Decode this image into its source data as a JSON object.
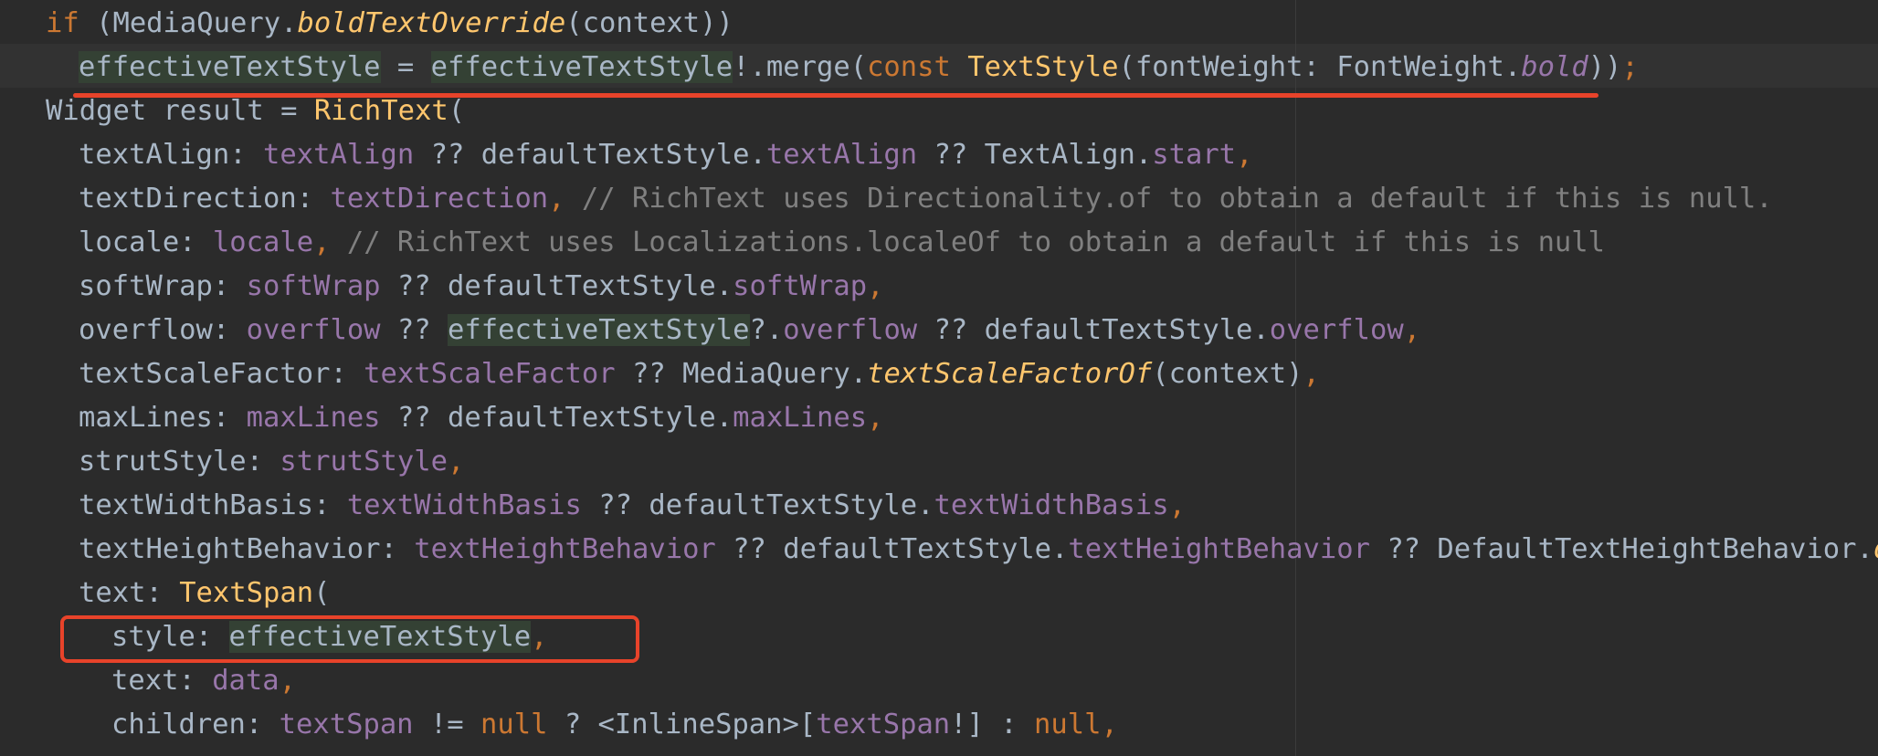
{
  "editor": {
    "colors": {
      "background": "#2b2b2b",
      "current_line": "#323232",
      "default_text": "#a9b7c6",
      "keyword": "#cc7832",
      "class_or_method": "#ffc66d",
      "field": "#9876aa",
      "comment": "#808080",
      "reference_highlight": "#344134",
      "annotation": "#e8432a"
    },
    "lines": [
      {
        "indent": 1,
        "tokens": [
          {
            "t": "if",
            "s": "kw"
          },
          {
            "t": " (MediaQuery.",
            "s": "plain"
          },
          {
            "t": "boldTextOverride",
            "s": "call"
          },
          {
            "t": "(context))",
            "s": "plain"
          }
        ]
      },
      {
        "indent": 2,
        "tokens": [
          {
            "t": "effectiveTextStyle",
            "s": "ref"
          },
          {
            "t": " = ",
            "s": "plain"
          },
          {
            "t": "effectiveTextStyle",
            "s": "ref"
          },
          {
            "t": "!.merge(",
            "s": "plain"
          },
          {
            "t": "const",
            "s": "kw"
          },
          {
            "t": " ",
            "s": "plain"
          },
          {
            "t": "TextStyle",
            "s": "cls"
          },
          {
            "t": "(fontWeight: FontWeight.",
            "s": "plain"
          },
          {
            "t": "bold",
            "s": "ital-fld"
          },
          {
            "t": "))",
            "s": "plain"
          },
          {
            "t": ";",
            "s": "kw"
          }
        ]
      },
      {
        "indent": 1,
        "tokens": [
          {
            "t": "Widget result = ",
            "s": "plain"
          },
          {
            "t": "RichText",
            "s": "cls"
          },
          {
            "t": "(",
            "s": "plain"
          }
        ]
      },
      {
        "indent": 2,
        "tokens": [
          {
            "t": "textAlign: ",
            "s": "plain"
          },
          {
            "t": "textAlign",
            "s": "fld"
          },
          {
            "t": " ?? defaultTextStyle.",
            "s": "plain"
          },
          {
            "t": "textAlign",
            "s": "fld"
          },
          {
            "t": " ?? TextAlign.",
            "s": "plain"
          },
          {
            "t": "start",
            "s": "fld"
          },
          {
            "t": ",",
            "s": "kw"
          }
        ]
      },
      {
        "indent": 2,
        "tokens": [
          {
            "t": "textDirection: ",
            "s": "plain"
          },
          {
            "t": "textDirection",
            "s": "fld"
          },
          {
            "t": ",",
            "s": "kw"
          },
          {
            "t": " // RichText uses Directionality.of to obtain a default if this is null.",
            "s": "cmt"
          }
        ]
      },
      {
        "indent": 2,
        "tokens": [
          {
            "t": "locale: ",
            "s": "plain"
          },
          {
            "t": "locale",
            "s": "fld"
          },
          {
            "t": ",",
            "s": "kw"
          },
          {
            "t": " // RichText uses Localizations.localeOf to obtain a default if this is null",
            "s": "cmt"
          }
        ]
      },
      {
        "indent": 2,
        "tokens": [
          {
            "t": "softWrap: ",
            "s": "plain"
          },
          {
            "t": "softWrap",
            "s": "fld"
          },
          {
            "t": " ?? defaultTextStyle.",
            "s": "plain"
          },
          {
            "t": "softWrap",
            "s": "fld"
          },
          {
            "t": ",",
            "s": "kw"
          }
        ]
      },
      {
        "indent": 2,
        "tokens": [
          {
            "t": "overflow: ",
            "s": "plain"
          },
          {
            "t": "overflow",
            "s": "fld"
          },
          {
            "t": " ?? ",
            "s": "plain"
          },
          {
            "t": "effectiveTextStyle",
            "s": "ref"
          },
          {
            "t": "?.",
            "s": "plain"
          },
          {
            "t": "overflow",
            "s": "fld"
          },
          {
            "t": " ?? defaultTextStyle.",
            "s": "plain"
          },
          {
            "t": "overflow",
            "s": "fld"
          },
          {
            "t": ",",
            "s": "kw"
          }
        ]
      },
      {
        "indent": 2,
        "tokens": [
          {
            "t": "textScaleFactor: ",
            "s": "plain"
          },
          {
            "t": "textScaleFactor",
            "s": "fld"
          },
          {
            "t": " ?? MediaQuery.",
            "s": "plain"
          },
          {
            "t": "textScaleFactorOf",
            "s": "call"
          },
          {
            "t": "(context)",
            "s": "plain"
          },
          {
            "t": ",",
            "s": "kw"
          }
        ]
      },
      {
        "indent": 2,
        "tokens": [
          {
            "t": "maxLines: ",
            "s": "plain"
          },
          {
            "t": "maxLines",
            "s": "fld"
          },
          {
            "t": " ?? defaultTextStyle.",
            "s": "plain"
          },
          {
            "t": "maxLines",
            "s": "fld"
          },
          {
            "t": ",",
            "s": "kw"
          }
        ]
      },
      {
        "indent": 2,
        "tokens": [
          {
            "t": "strutStyle: ",
            "s": "plain"
          },
          {
            "t": "strutStyle",
            "s": "fld"
          },
          {
            "t": ",",
            "s": "kw"
          }
        ]
      },
      {
        "indent": 2,
        "tokens": [
          {
            "t": "textWidthBasis: ",
            "s": "plain"
          },
          {
            "t": "textWidthBasis",
            "s": "fld"
          },
          {
            "t": " ?? defaultTextStyle.",
            "s": "plain"
          },
          {
            "t": "textWidthBasis",
            "s": "fld"
          },
          {
            "t": ",",
            "s": "kw"
          }
        ]
      },
      {
        "indent": 2,
        "tokens": [
          {
            "t": "textHeightBehavior: ",
            "s": "plain"
          },
          {
            "t": "textHeightBehavior",
            "s": "fld"
          },
          {
            "t": " ?? defaultTextStyle.",
            "s": "plain"
          },
          {
            "t": "textHeightBehavior",
            "s": "fld"
          },
          {
            "t": " ?? DefaultTextHeightBehavior.",
            "s": "plain"
          },
          {
            "t": "of",
            "s": "call"
          },
          {
            "t": "(",
            "s": "plain"
          }
        ]
      },
      {
        "indent": 2,
        "tokens": [
          {
            "t": "text: ",
            "s": "plain"
          },
          {
            "t": "TextSpan",
            "s": "cls"
          },
          {
            "t": "(",
            "s": "plain"
          }
        ]
      },
      {
        "indent": 3,
        "tokens": [
          {
            "t": "style: ",
            "s": "plain"
          },
          {
            "t": "effectiveTextStyle",
            "s": "ref"
          },
          {
            "t": ",",
            "s": "kw"
          }
        ]
      },
      {
        "indent": 3,
        "tokens": [
          {
            "t": "text: ",
            "s": "plain"
          },
          {
            "t": "data",
            "s": "fld"
          },
          {
            "t": ",",
            "s": "kw"
          }
        ]
      },
      {
        "indent": 3,
        "tokens": [
          {
            "t": "children: ",
            "s": "plain"
          },
          {
            "t": "textSpan",
            "s": "fld"
          },
          {
            "t": " != ",
            "s": "plain"
          },
          {
            "t": "null",
            "s": "kw"
          },
          {
            "t": " ? <InlineSpan>[",
            "s": "plain"
          },
          {
            "t": "textSpan",
            "s": "fld"
          },
          {
            "t": "!] : ",
            "s": "plain"
          },
          {
            "t": "null",
            "s": "kw"
          },
          {
            "t": ",",
            "s": "kw"
          }
        ]
      },
      {
        "indent": 2,
        "tokens": [
          {
            "t": "),",
            "s": "plain"
          }
        ]
      }
    ]
  }
}
